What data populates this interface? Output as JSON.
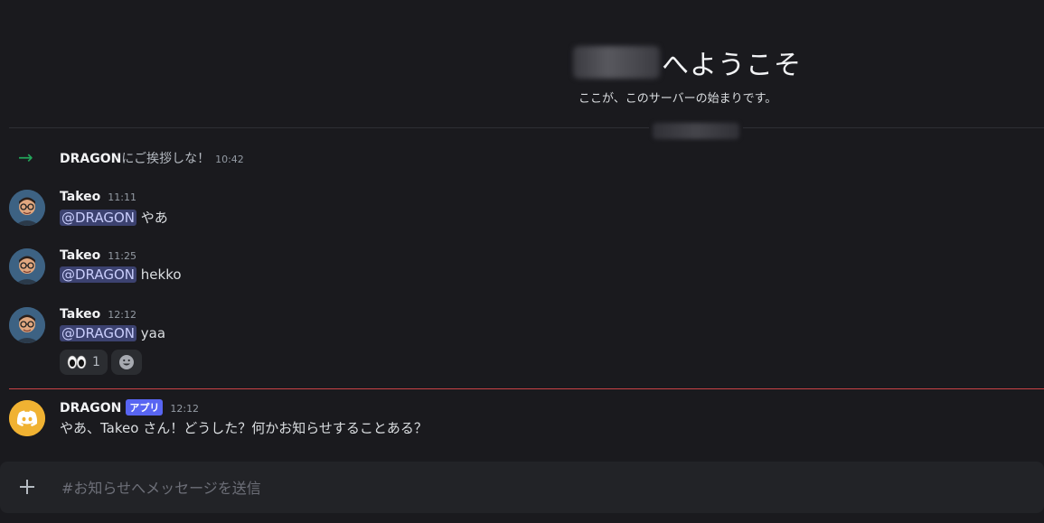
{
  "welcome": {
    "title_suffix": "へようこそ",
    "subtitle": "ここが、このサーバーの始まりです。"
  },
  "join": {
    "user": "DRAGON",
    "text": "にご挨拶しな！",
    "time": "10:42"
  },
  "messages": [
    {
      "user": "Takeo",
      "time": "11:11",
      "mention": "@DRAGON",
      "text": "やあ"
    },
    {
      "user": "Takeo",
      "time": "11:25",
      "mention": "@DRAGON",
      "text": "hekko"
    },
    {
      "user": "Takeo",
      "time": "12:12",
      "mention": "@DRAGON",
      "text": "yaa",
      "reactions": [
        {
          "emoji": "👀",
          "count": "1"
        }
      ]
    }
  ],
  "bot_message": {
    "user": "DRAGON",
    "tag": "アプリ",
    "time": "12:12",
    "text": "やあ、Takeo さん！どうした？何かお知らせすることある？"
  },
  "composer": {
    "placeholder": "#お知らせへメッセージを送信"
  },
  "colors": {
    "background": "#1a1a1e",
    "mention_bg": "#3c4270",
    "join_arrow": "#23a55a",
    "new_divider": "#c94346",
    "bot_avatar": "#f0b232",
    "bot_tag": "#5865f2"
  }
}
